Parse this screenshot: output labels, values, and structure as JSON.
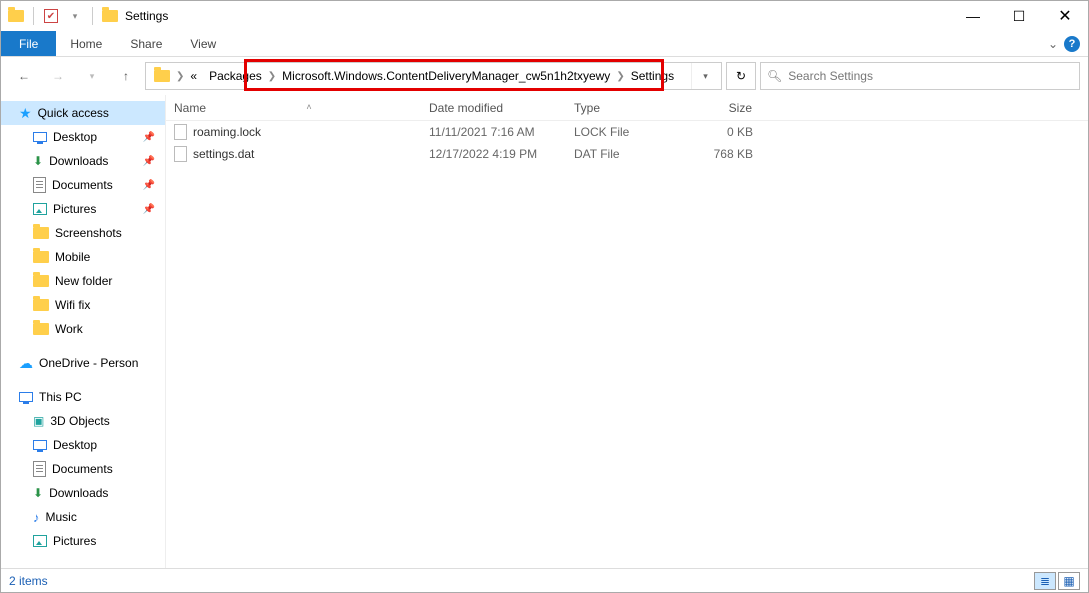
{
  "window": {
    "title": "Settings"
  },
  "ribbon": {
    "file": "File",
    "tabs": [
      "Home",
      "Share",
      "View"
    ]
  },
  "breadcrumb": {
    "ellipsis": "«",
    "seg1": "Packages",
    "seg2": "Microsoft.Windows.ContentDeliveryManager_cw5n1h2txyewy",
    "seg3": "Settings"
  },
  "search": {
    "placeholder": "Search Settings"
  },
  "nav": {
    "quick_access": "Quick access",
    "items_pinned": [
      "Desktop",
      "Downloads",
      "Documents",
      "Pictures"
    ],
    "items_recent": [
      "Screenshots",
      "Mobile",
      "New folder",
      "Wifi fix",
      "Work"
    ],
    "onedrive": "OneDrive - Person",
    "this_pc": "This PC",
    "pc_children": [
      "3D Objects",
      "Desktop",
      "Documents",
      "Downloads",
      "Music",
      "Pictures"
    ]
  },
  "columns": {
    "name": "Name",
    "date": "Date modified",
    "type": "Type",
    "size": "Size"
  },
  "files": [
    {
      "name": "roaming.lock",
      "date": "11/11/2021 7:16 AM",
      "type": "LOCK File",
      "size": "0 KB"
    },
    {
      "name": "settings.dat",
      "date": "12/17/2022 4:19 PM",
      "type": "DAT File",
      "size": "768 KB"
    }
  ],
  "status": {
    "count": "2 items"
  }
}
